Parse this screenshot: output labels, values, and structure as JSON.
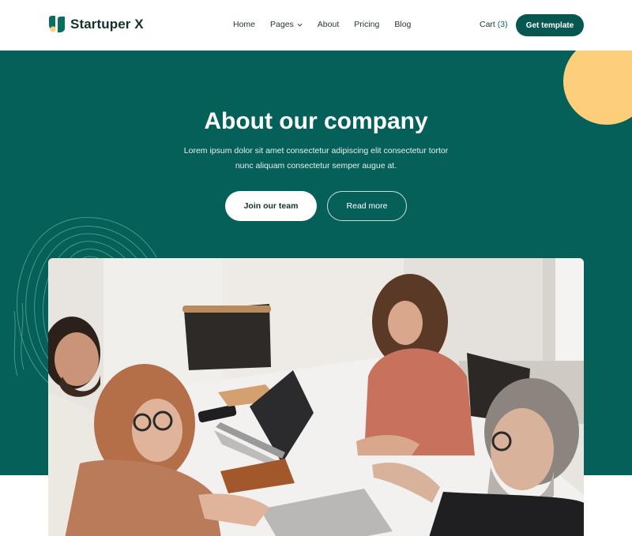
{
  "brand": {
    "name": "Startuper X"
  },
  "nav": {
    "items": [
      {
        "label": "Home"
      },
      {
        "label": "Pages",
        "has_dropdown": true
      },
      {
        "label": "About"
      },
      {
        "label": "Pricing"
      },
      {
        "label": "Blog"
      }
    ]
  },
  "cart": {
    "label": "Cart",
    "count": "(3)"
  },
  "header_cta": {
    "label": "Get template"
  },
  "hero": {
    "title": "About our company",
    "description": "Lorem ipsum dolor sit amet consectetur adipiscing elit consectetur tortor nunc aliquam consectetur semper augue at.",
    "primary_button": "Join our team",
    "secondary_button": "Read more"
  },
  "colors": {
    "brand_green": "#06605a",
    "button_green": "#06574f",
    "accent_yellow": "#fdcf7a",
    "white": "#ffffff"
  },
  "icons": [
    "logo-mark-icon",
    "chevron-down-icon",
    "contour-lines-decoration",
    "sun-circle-decoration"
  ]
}
